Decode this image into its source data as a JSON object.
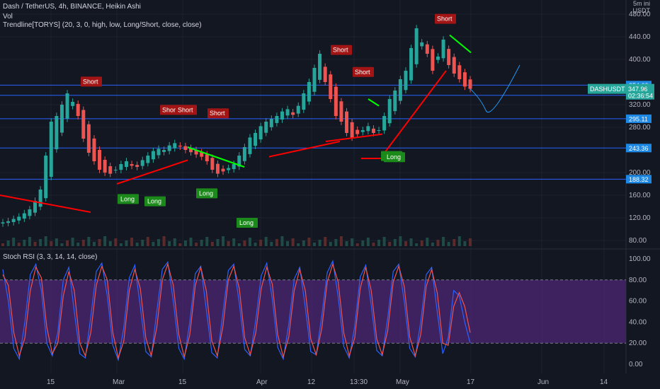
{
  "header": {
    "line1": "Dash / TetherUS, 4h, BINANCE, Heikin Ashi",
    "line2": "Vol",
    "line3": "Trendline[TORYS] (20, 3, 0, high, low, Long/Short, close, close)"
  },
  "corner": {
    "interval": "5m ini",
    "currency": "USDT"
  },
  "rsi_header": "Stoch RSI (3, 3, 14, 14, close)",
  "colors": {
    "background": "#131722",
    "up": "#26a69a",
    "down": "#ef5350",
    "horizontal_line": "#2962ff",
    "trend_red": "#ff0000",
    "trend_green": "#00ff00",
    "long_badge": "#1b8a1b",
    "short_badge": "#a31515",
    "rsi_k": "#2962ff",
    "rsi_d": "#ef5350",
    "rsi_band": "#4a2670",
    "price_tag": "#26a69a",
    "level_tag": "#1e88e5"
  },
  "chart_data": [
    {
      "type": "candlestick",
      "title": "Dash / TetherUS, 4h, BINANCE, Heikin Ashi",
      "y_ticks": [
        "480.00",
        "440.00",
        "400.00",
        "320.00",
        "280.00",
        "200.00",
        "160.00",
        "120.00",
        "80.00"
      ],
      "x_ticks": [
        "15",
        "Mar",
        "15",
        "Apr",
        "12",
        "13:30",
        "May",
        "17",
        "Jun",
        "14"
      ],
      "ylim": [
        70,
        495
      ],
      "current_price": 347.96,
      "countdown": "02:36:54",
      "symbol_tag": "DASHUSDT",
      "level_tags": [
        "354.60",
        "336.60",
        "295.11",
        "243.36",
        "188.32"
      ],
      "levels": [
        354.6,
        336.6,
        295.11,
        243.36,
        188.32
      ],
      "closes": [
        112,
        114,
        118,
        122,
        128,
        135,
        150,
        170,
        230,
        290,
        300,
        320,
        340,
        325,
        300,
        260,
        235,
        220,
        205,
        200,
        198,
        205,
        215,
        220,
        212,
        210,
        222,
        230,
        238,
        242,
        240,
        248,
        252,
        246,
        240,
        236,
        232,
        228,
        220,
        205,
        198,
        202,
        208,
        215,
        230,
        245,
        262,
        270,
        282,
        290,
        295,
        300,
        308,
        312,
        302,
        318,
        340,
        360,
        385,
        410,
        360,
        330,
        300,
        290,
        270,
        262,
        268,
        275,
        282,
        270,
        275,
        300,
        330,
        345,
        365,
        380,
        420,
        455,
        430,
        410,
        380,
        405,
        435,
        390,
        375,
        365,
        352,
        348
      ],
      "long_signals": [
        {
          "label": "Long",
          "price": 162
        },
        {
          "label": "Long",
          "price": 158
        },
        {
          "label": "Long",
          "price": 172
        },
        {
          "label": "Long",
          "price": 120
        },
        {
          "label": "Long",
          "price": 238
        },
        {
          "label": "Long",
          "price": 236
        }
      ],
      "short_signals": [
        {
          "label": "Short",
          "price": 352
        },
        {
          "label": "Short",
          "price": 302
        },
        {
          "label": "Short",
          "price": 302
        },
        {
          "label": "Short",
          "price": 296
        },
        {
          "label": "Short",
          "price": 408
        },
        {
          "label": "Short",
          "price": 369
        },
        {
          "label": "Short",
          "price": 463
        }
      ]
    },
    {
      "type": "line",
      "title": "Stoch RSI (3, 3, 14, 14, close)",
      "y_ticks": [
        "100.00",
        "80.00",
        "60.00",
        "40.00",
        "20.00",
        "0.00"
      ],
      "ylim": [
        0,
        100
      ],
      "band": [
        20,
        80
      ],
      "series": [
        {
          "values": [
            90,
            60,
            15,
            5,
            40,
            85,
            95,
            70,
            20,
            8,
            30,
            80,
            92,
            50,
            10,
            6,
            45,
            88,
            96,
            65,
            18,
            4,
            35,
            82,
            94,
            55,
            12,
            7,
            50,
            90,
            97,
            60,
            15,
            5,
            40,
            86,
            93,
            52,
            11,
            6,
            48,
            89,
            95,
            58,
            14,
            8,
            42,
            84,
            96,
            62,
            16,
            5,
            38,
            81,
            92,
            54,
            12,
            9,
            46,
            87,
            98,
            64,
            17,
            6,
            36,
            83,
            94,
            56,
            13,
            8,
            44,
            88,
            95,
            60,
            15,
            7,
            40,
            85,
            92,
            50,
            10,
            25,
            70,
            65,
            40,
            20
          ]
        },
        {
          "values": [
            85,
            75,
            30,
            8,
            25,
            70,
            92,
            82,
            35,
            10,
            20,
            65,
            88,
            70,
            20,
            8,
            30,
            75,
            93,
            80,
            30,
            6,
            22,
            70,
            90,
            72,
            25,
            8,
            35,
            80,
            95,
            75,
            28,
            7,
            28,
            75,
            92,
            70,
            22,
            8,
            35,
            80,
            93,
            72,
            25,
            9,
            30,
            72,
            92,
            76,
            28,
            7,
            26,
            70,
            90,
            70,
            24,
            9,
            34,
            78,
            95,
            78,
            30,
            8,
            25,
            72,
            92,
            70,
            24,
            9,
            32,
            78,
            93,
            74,
            26,
            8,
            28,
            74,
            90,
            68,
            20,
            18,
            55,
            68,
            55,
            30
          ]
        }
      ]
    }
  ]
}
